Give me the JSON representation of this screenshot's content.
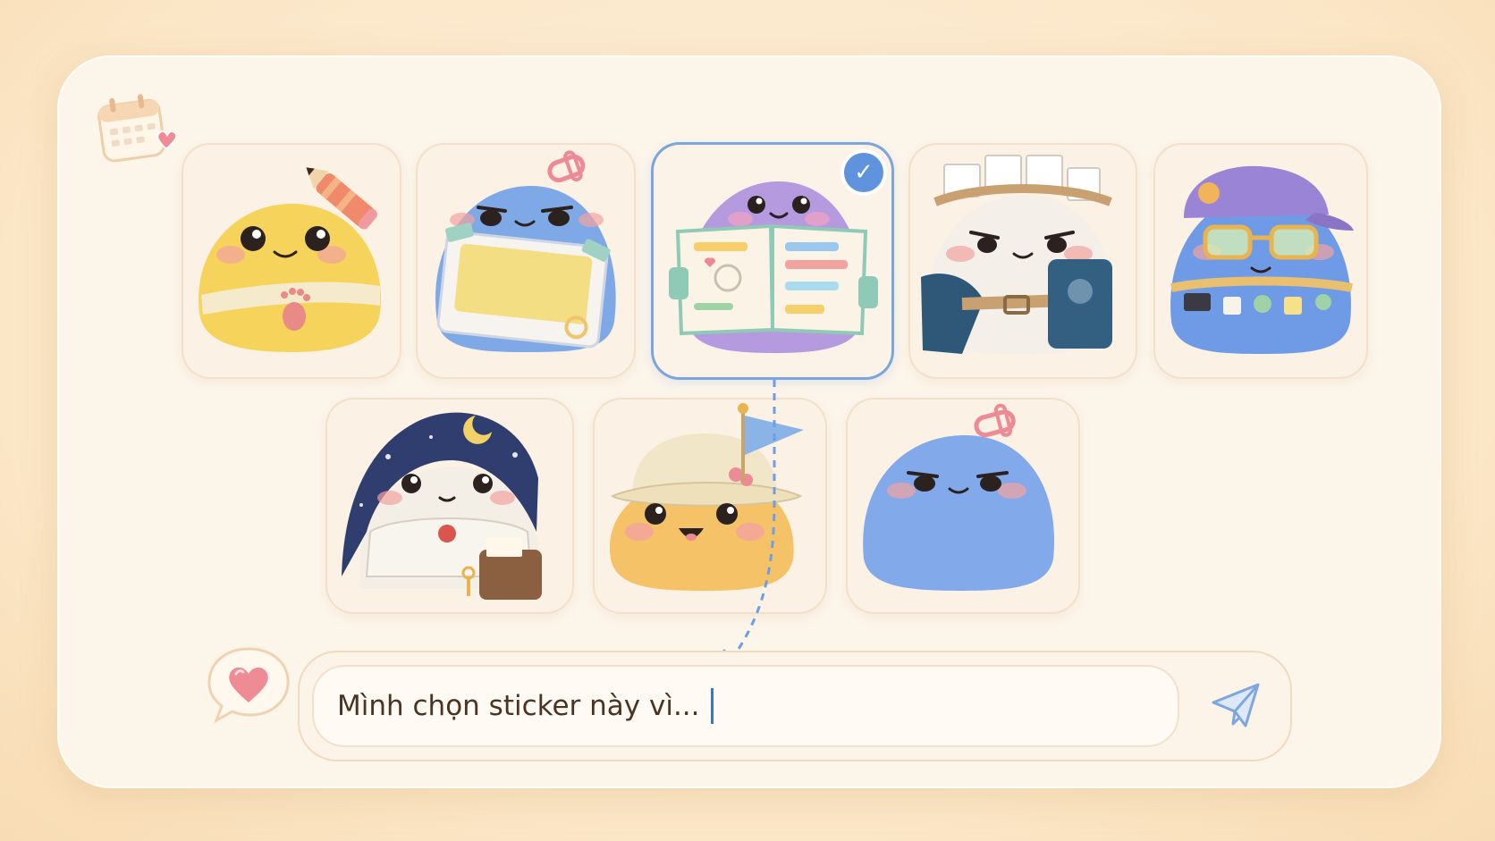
{
  "stickers": [
    {
      "name": "yellow-pencil-blob",
      "color": "#f6d35a",
      "selected": false
    },
    {
      "name": "blue-photo-frame-blob",
      "color": "#7fa8e6",
      "selected": false
    },
    {
      "name": "purple-journal-blob",
      "color": "#b59ae0",
      "selected": true
    },
    {
      "name": "white-explorer-blob",
      "color": "#f4efe8",
      "selected": false
    },
    {
      "name": "blue-cap-glasses-blob",
      "color": "#6f9be6",
      "selected": false
    },
    {
      "name": "white-wizard-blob",
      "color": "#f3eee6",
      "selected": false
    },
    {
      "name": "orange-bucket-hat-blob",
      "color": "#f6c267",
      "selected": false
    },
    {
      "name": "blue-plain-blob",
      "color": "#82a9ea",
      "selected": false
    }
  ],
  "message_input": {
    "value": "Mình chọn sticker này vì..."
  },
  "colors": {
    "accent": "#5f93de",
    "text": "#4a3424",
    "heart": "#ef8b94"
  },
  "icons": {
    "calendar": "calendar-heart-icon",
    "check": "check-icon",
    "heart_bubble": "heart-speech-bubble-icon",
    "send": "paper-plane-icon"
  }
}
